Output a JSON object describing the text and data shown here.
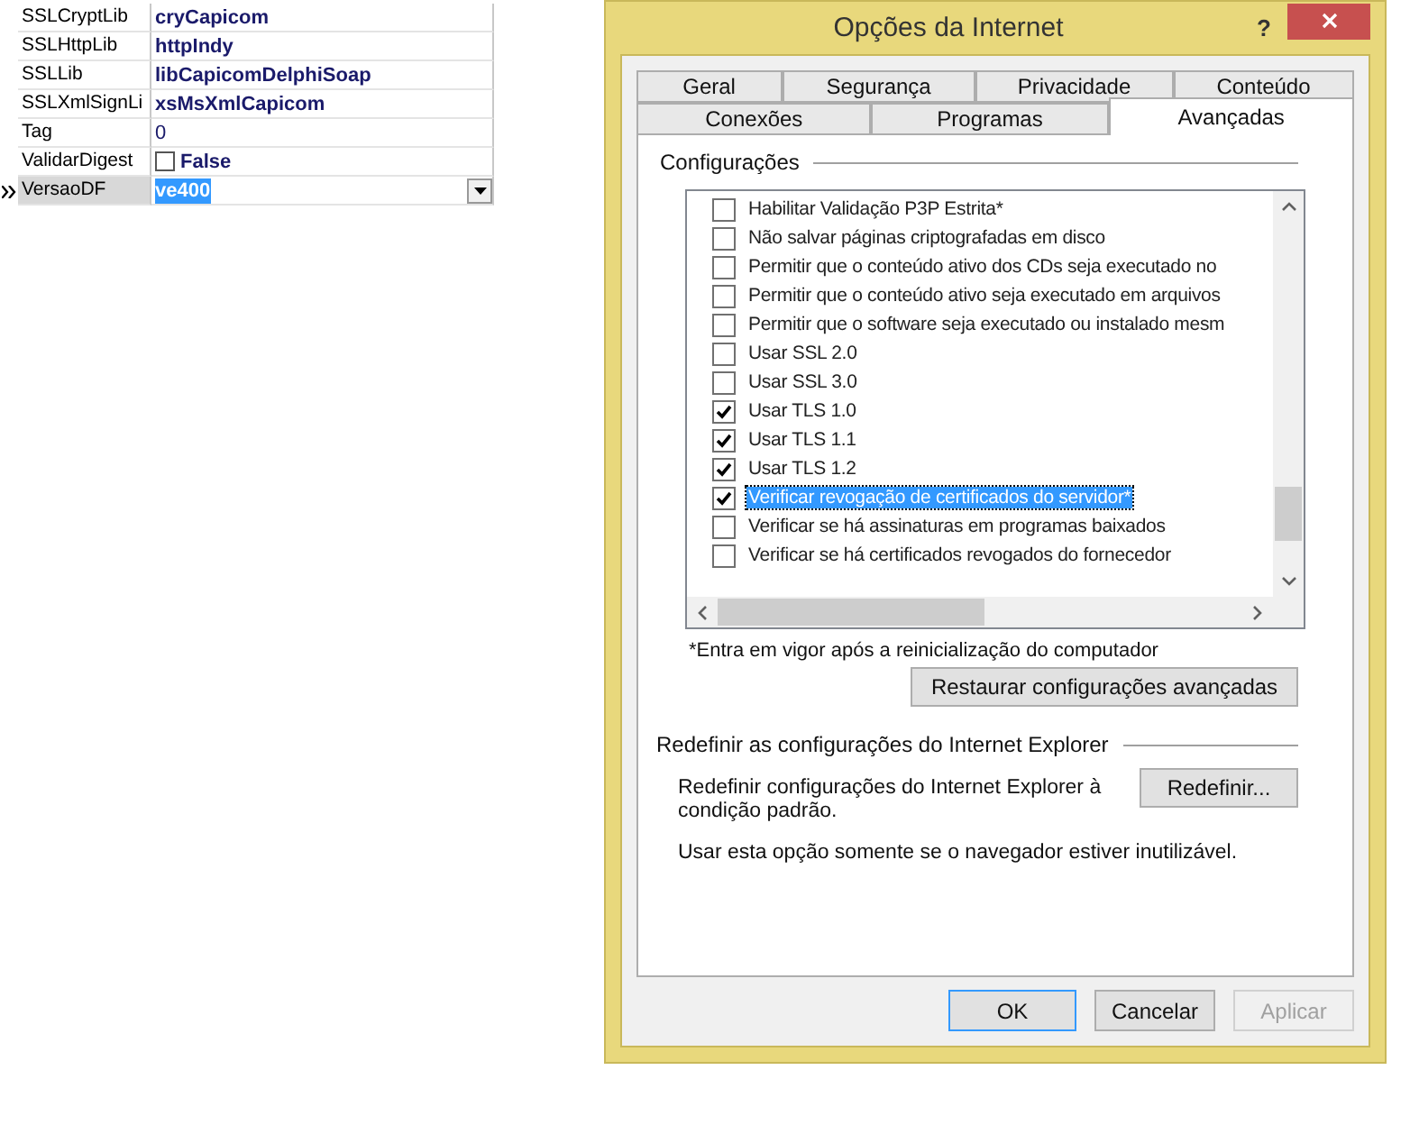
{
  "property_grid": {
    "rows": [
      {
        "name": "SSLCryptLib",
        "value": "cryCapicom",
        "kind": "text",
        "bold": true,
        "selected": false
      },
      {
        "name": "SSLHttpLib",
        "value": "httpIndy",
        "kind": "text",
        "bold": true,
        "selected": false
      },
      {
        "name": "SSLLib",
        "value": "libCapicomDelphiSoap",
        "kind": "text",
        "bold": true,
        "selected": false
      },
      {
        "name": "SSLXmlSignLi",
        "value": "xsMsXmlCapicom",
        "kind": "text",
        "bold": true,
        "selected": false
      },
      {
        "name": "Tag",
        "value": "0",
        "kind": "text",
        "bold": false,
        "selected": false
      },
      {
        "name": "ValidarDigest",
        "value": "False",
        "kind": "checkbox",
        "checked": false,
        "bold": true,
        "selected": false
      },
      {
        "name": "VersaoDF",
        "value": "ve400",
        "kind": "dropdown",
        "bold": true,
        "selected": true
      }
    ]
  },
  "dialog": {
    "title": "Opções da Internet",
    "help_button": "?",
    "tab_rows": [
      {
        "tabs": [
          {
            "label": "Geral",
            "selected": false
          },
          {
            "label": "Segurança",
            "selected": false
          },
          {
            "label": "Privacidade",
            "selected": false
          },
          {
            "label": "Conteúdo",
            "selected": false
          }
        ]
      },
      {
        "tabs": [
          {
            "label": "Conexões",
            "selected": false
          },
          {
            "label": "Programas",
            "selected": false
          },
          {
            "label": "Avançadas",
            "selected": true
          }
        ]
      }
    ],
    "settings_group": {
      "label": "Configurações",
      "items": [
        {
          "label": "Habilitar Validação P3P Estrita*",
          "checked": false,
          "selected": false
        },
        {
          "label": "Não salvar páginas criptografadas em disco",
          "checked": false,
          "selected": false
        },
        {
          "label": "Permitir que o conteúdo ativo dos CDs seja executado no",
          "checked": false,
          "selected": false
        },
        {
          "label": "Permitir que o conteúdo ativo seja executado em arquivos",
          "checked": false,
          "selected": false
        },
        {
          "label": "Permitir que o software seja executado ou instalado mesm",
          "checked": false,
          "selected": false
        },
        {
          "label": "Usar SSL 2.0",
          "checked": false,
          "selected": false
        },
        {
          "label": "Usar SSL 3.0",
          "checked": false,
          "selected": false
        },
        {
          "label": "Usar TLS 1.0",
          "checked": true,
          "selected": false
        },
        {
          "label": "Usar TLS 1.1",
          "checked": true,
          "selected": false
        },
        {
          "label": "Usar TLS 1.2",
          "checked": true,
          "selected": false
        },
        {
          "label": "Verificar revogação de certificados do servidor*",
          "checked": true,
          "selected": true
        },
        {
          "label": "Verificar se há assinaturas em programas baixados",
          "checked": false,
          "selected": false
        },
        {
          "label": "Verificar se há certificados revogados do fornecedor",
          "checked": false,
          "selected": false
        }
      ],
      "footnote": "*Entra em vigor após a reinicialização do computador",
      "restore_button": "Restaurar configurações avançadas"
    },
    "reset_group": {
      "label": "Redefinir as configurações do Internet Explorer",
      "description": "Redefinir configurações do Internet Explorer à condição padrão.",
      "reset_button": "Redefinir...",
      "note": "Usar esta opção somente se o navegador estiver inutilizável."
    },
    "buttons": [
      {
        "label": "OK",
        "kind": "default",
        "disabled": false
      },
      {
        "label": "Cancelar",
        "kind": "normal",
        "disabled": false
      },
      {
        "label": "Aplicar",
        "kind": "normal",
        "disabled": true
      }
    ]
  }
}
